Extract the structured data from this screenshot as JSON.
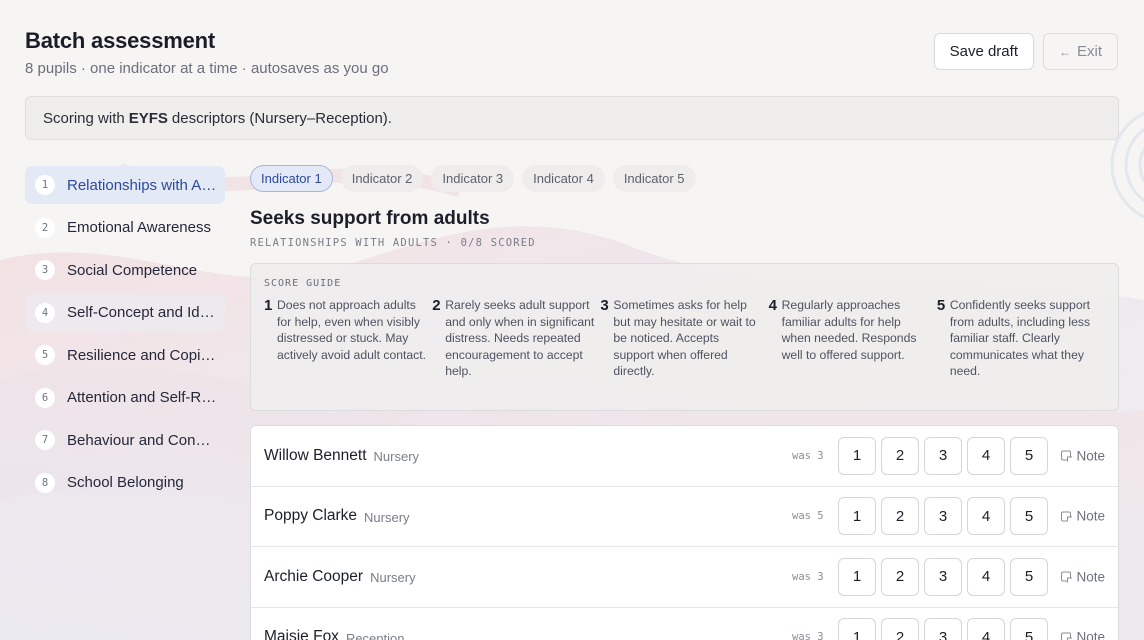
{
  "header": {
    "title": "Batch assessment",
    "subtitle": "8 pupils · one indicator at a time · autosaves as you go"
  },
  "actions": {
    "save_label": "Save draft",
    "exit_label": "Exit",
    "exit_icon": "arrow-left-icon"
  },
  "banner": {
    "prefix": "Scoring with",
    "framework": "EYFS",
    "suffix": "descriptors (Nursery–Reception)."
  },
  "sidebar": {
    "items": [
      {
        "num": "1",
        "label": "Relationships with Adults"
      },
      {
        "num": "2",
        "label": "Emotional Awareness"
      },
      {
        "num": "3",
        "label": "Social Competence"
      },
      {
        "num": "4",
        "label": "Self-Concept and Identity"
      },
      {
        "num": "5",
        "label": "Resilience and Coping"
      },
      {
        "num": "6",
        "label": "Attention and Self-Regulation"
      },
      {
        "num": "7",
        "label": "Behaviour and Conduct"
      },
      {
        "num": "8",
        "label": "School Belonging"
      }
    ]
  },
  "tabs": [
    "Indicator 1",
    "Indicator 2",
    "Indicator 3",
    "Indicator 4",
    "Indicator 5"
  ],
  "indicator": {
    "title": "Seeks support from adults",
    "meta": "RELATIONSHIPS WITH ADULTS · 0/8 SCORED"
  },
  "score_guide": {
    "title": "SCORE GUIDE",
    "levels": [
      {
        "num": "1",
        "text": "Does not approach adults for help, even when visibly distressed or stuck. May actively avoid adult contact."
      },
      {
        "num": "2",
        "text": "Rarely seeks adult support and only when in significant distress. Needs repeated encouragement to accept help."
      },
      {
        "num": "3",
        "text": "Sometimes asks for help but may hesitate or wait to be noticed. Accepts support when offered directly."
      },
      {
        "num": "4",
        "text": "Regularly approaches familiar adults for help when needed. Responds well to offered support."
      },
      {
        "num": "5",
        "text": "Confidently seeks support from adults, including less familiar staff. Clearly communicates what they need."
      }
    ]
  },
  "score_options": [
    "1",
    "2",
    "3",
    "4",
    "5"
  ],
  "note_label": "Note",
  "pupils": [
    {
      "name": "Willow Bennett",
      "grade": "Nursery",
      "was": "was 3"
    },
    {
      "name": "Poppy Clarke",
      "grade": "Nursery",
      "was": "was 5"
    },
    {
      "name": "Archie Cooper",
      "grade": "Nursery",
      "was": "was 3"
    },
    {
      "name": "Maisie Fox",
      "grade": "Reception",
      "was": "was 3"
    }
  ],
  "colors": {
    "accent": "#2d4a9a",
    "accent_bg": "#e3e9f7",
    "page_bg": "#f6f5f4"
  }
}
